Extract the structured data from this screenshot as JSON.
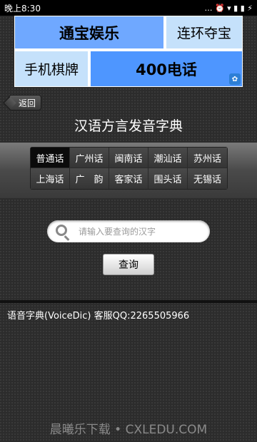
{
  "status_bar": {
    "time": "晚上8:30",
    "icons": "… ⏰ ▾ ▮ ▮ ⚡"
  },
  "ad": {
    "cell1": "通宝娱乐",
    "cell2": "连环夺宝",
    "cell3": "手机棋牌",
    "cell4": "400电话",
    "paw_icon": "paw-icon"
  },
  "back_label": "返回",
  "page_title": "汉语方言发音字典",
  "dialects": [
    {
      "label": "普通话",
      "selected": true
    },
    {
      "label": "广州话",
      "selected": false
    },
    {
      "label": "闽南话",
      "selected": false
    },
    {
      "label": "潮汕话",
      "selected": false
    },
    {
      "label": "苏州话",
      "selected": false
    },
    {
      "label": "上海话",
      "selected": false
    },
    {
      "label": "广　韵",
      "selected": false
    },
    {
      "label": "客家话",
      "selected": false
    },
    {
      "label": "围头话",
      "selected": false
    },
    {
      "label": "无锡话",
      "selected": false
    }
  ],
  "search": {
    "placeholder": "请输入要查询的汉字",
    "value": ""
  },
  "query_label": "查询",
  "footer_text": "语音字典(VoiceDic)  客服QQ:2265505966",
  "watermark": "晨曦乐下载 • CXLEDU.COM"
}
